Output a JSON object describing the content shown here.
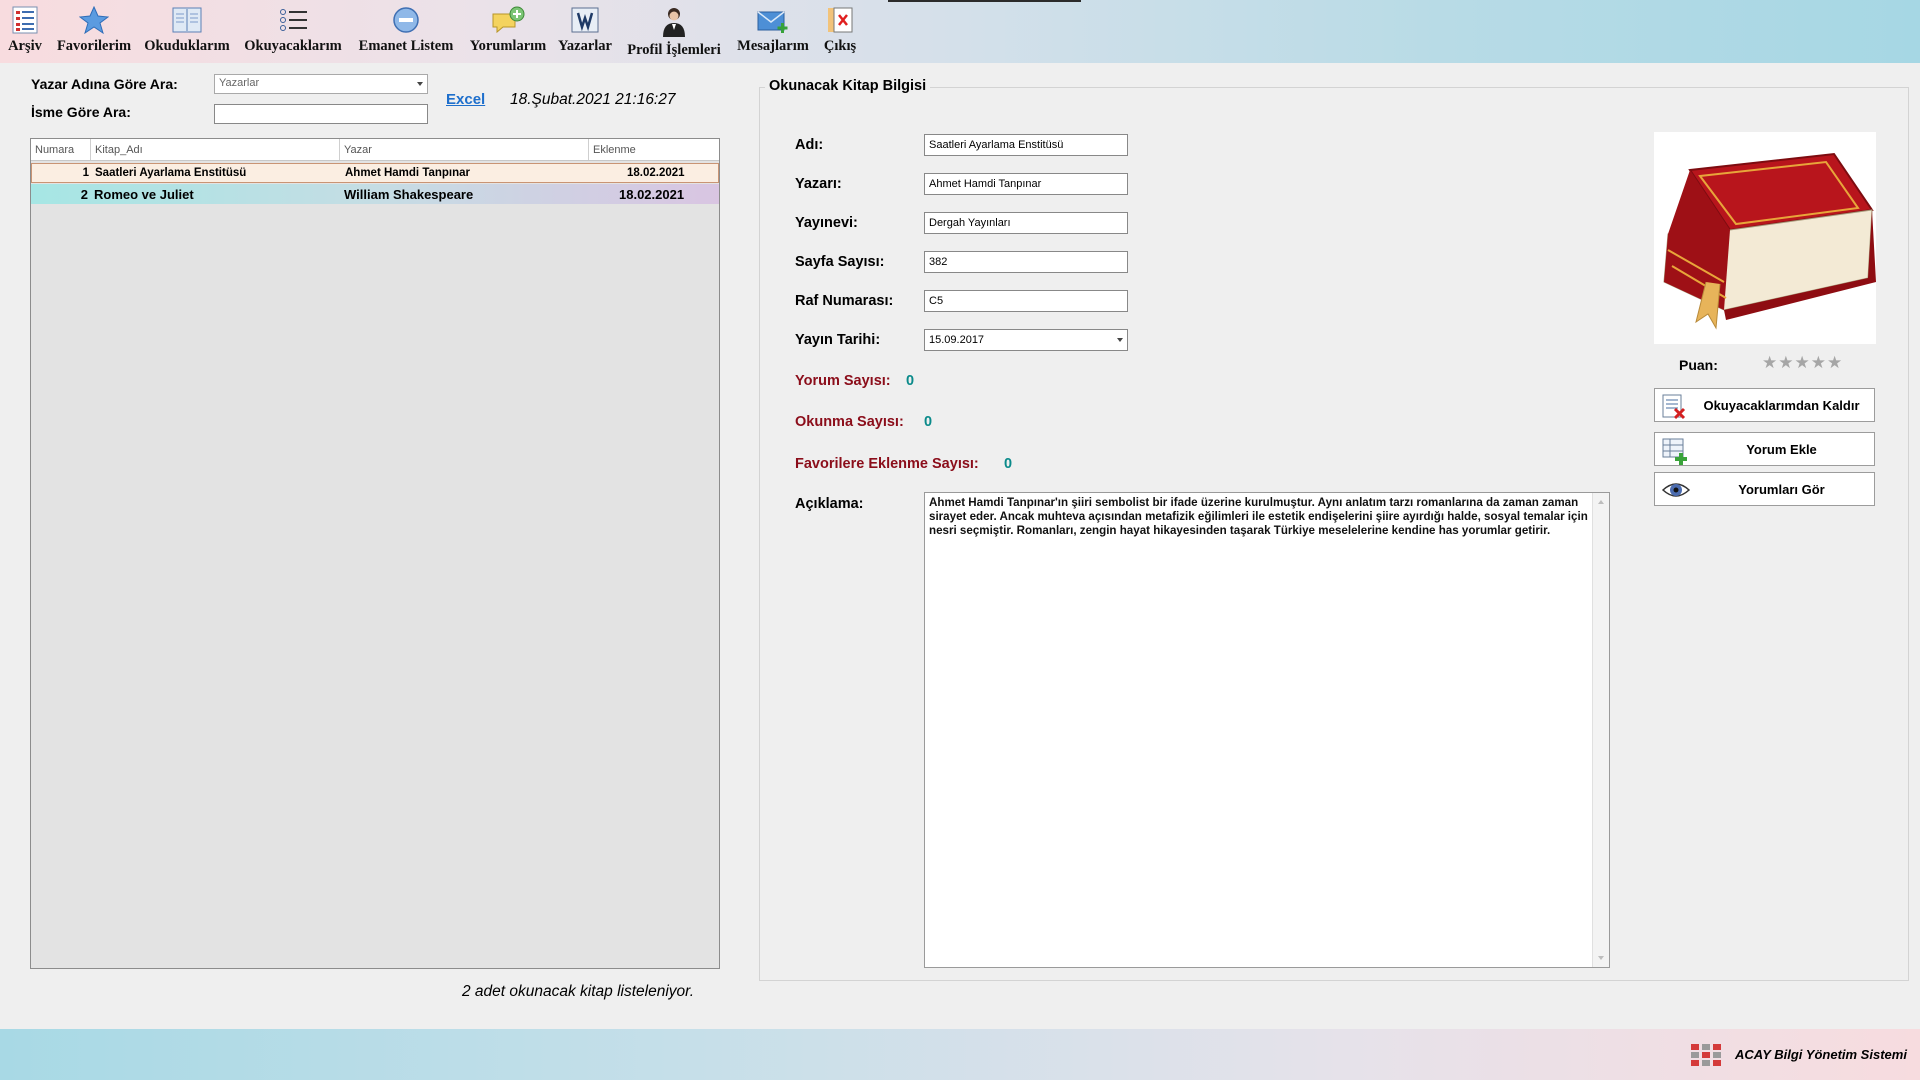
{
  "toolbar": {
    "items": [
      {
        "label": "Arşiv",
        "icon": "archive-list-icon"
      },
      {
        "label": "Favorilerim",
        "icon": "star-icon"
      },
      {
        "label": "Okuduklarım",
        "icon": "open-book-icon"
      },
      {
        "label": "Okuyacaklarım",
        "icon": "bullet-list-icon"
      },
      {
        "label": "Emanet Listem",
        "icon": "minus-circle-icon"
      },
      {
        "label": "Yorumlarım",
        "icon": "comment-add-icon"
      },
      {
        "label": "Yazarlar",
        "icon": "writer-book-icon"
      },
      {
        "label": "Profil İşlemleri",
        "icon": "person-icon"
      },
      {
        "label": "Mesajlarım",
        "icon": "mail-add-icon"
      },
      {
        "label": "Çıkış",
        "icon": "exit-icon"
      }
    ]
  },
  "search": {
    "author_label": "Yazar Adına Göre Ara:",
    "author_placeholder": "Yazarlar",
    "name_label": "İsme Göre Ara:",
    "name_value": "",
    "excel_label": "Excel",
    "datetime": "18.Şubat.2021 21:16:27"
  },
  "grid": {
    "columns": [
      "Numara",
      "Kitap_Adı",
      "Yazar",
      "Eklenme"
    ],
    "rows": [
      {
        "no": "1",
        "title": "Saatleri Ayarlama Enstitüsü",
        "author": "Ahmet Hamdi Tanpınar",
        "date": "18.02.2021"
      },
      {
        "no": "2",
        "title": "Romeo ve Juliet",
        "author": "William Shakespeare",
        "date": "18.02.2021"
      }
    ]
  },
  "listed_info": "2 adet okunacak kitap listeleniyor.",
  "details": {
    "group_title": "Okunacak Kitap Bilgisi",
    "name_label": "Adı:",
    "name": "Saatleri Ayarlama Enstitüsü",
    "author_label": "Yazarı:",
    "author": "Ahmet Hamdi Tanpınar",
    "publisher_label": "Yayınevi:",
    "publisher": "Dergah Yayınları",
    "pages_label": "Sayfa Sayısı:",
    "pages": "382",
    "shelf_label": "Raf Numarası:",
    "shelf": "C5",
    "pubdate_label": "Yayın Tarihi:",
    "pubdate": "15.09.2017",
    "comment_count_label": "Yorum Sayısı:",
    "comment_count": "0",
    "read_count_label": "Okunma Sayısı:",
    "read_count": "0",
    "fav_count_label": "Favorilere Eklenme Sayısı:",
    "fav_count": "0",
    "desc_label": "Açıklama:",
    "description": "Ahmet Hamdi Tanpınar'ın şiiri sembolist bir ifade üzerine kurulmuştur. Aynı anlatım tarzı romanlarına da zaman zaman sirayet eder. Ancak muhteva açısından metafizik eğilimleri ile estetik endişelerini şiire ayırdığı halde, sosyal temalar için nesri seçmiştir. Romanları, zengin hayat hikayesinden taşarak Türkiye meselelerine kendine has yorumlar getirir."
  },
  "rating": {
    "label": "Puan:",
    "stars_filled": 0,
    "stars_total": 5,
    "stars_text": "★★★★★"
  },
  "actions": {
    "remove": "Okuyacaklarımdan Kaldır",
    "add_comment": "Yorum Ekle",
    "view_comments": "Yorumları Gör"
  },
  "status": {
    "app_name": "ACAY Bilgi Yönetim Sistemi"
  },
  "colors": {
    "stat_label": "#8b0d1a",
    "stat_value": "#0a8a8a",
    "link": "#1e6fcc"
  }
}
